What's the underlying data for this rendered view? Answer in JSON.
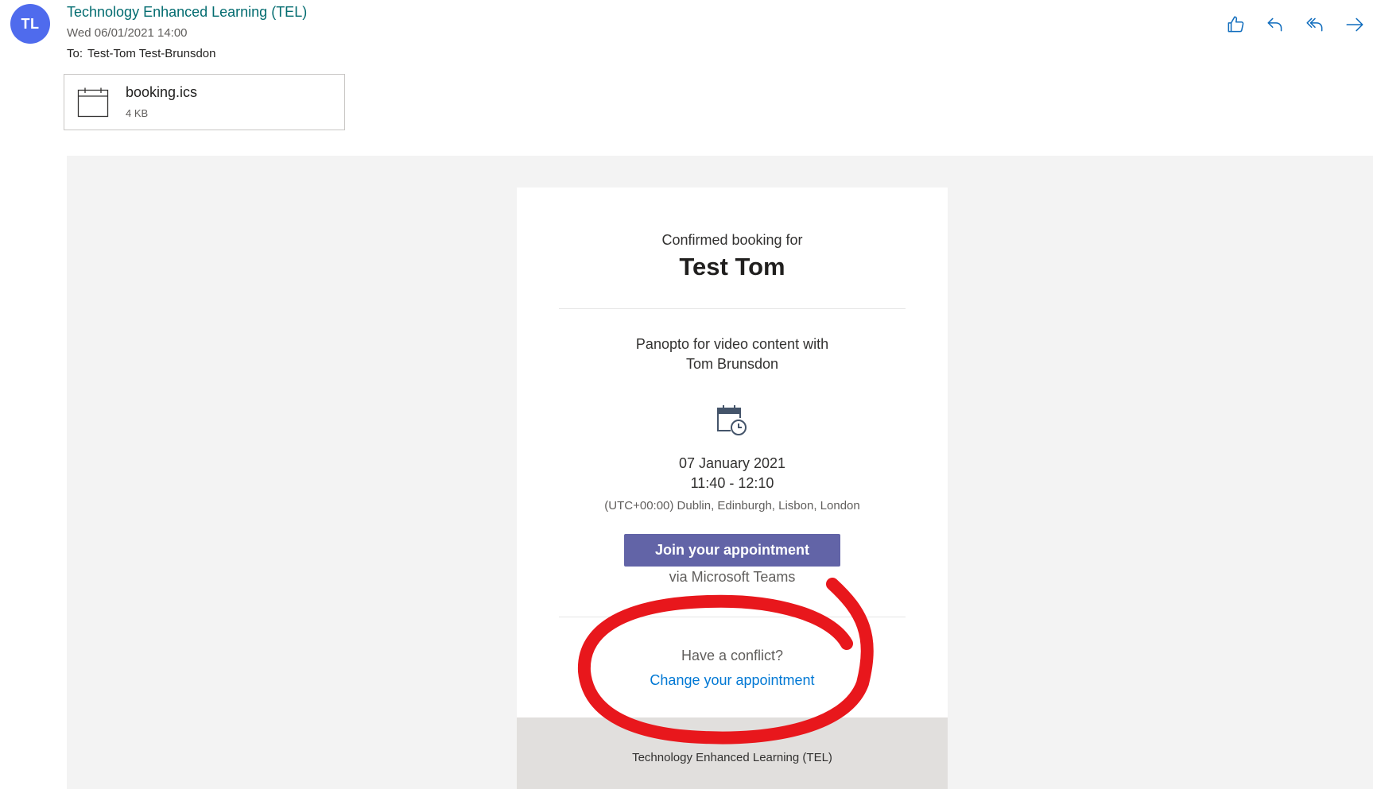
{
  "header": {
    "avatar_initials": "TL",
    "avatar_color": "#4f6bed",
    "sender_name": "Technology Enhanced Learning (TEL)",
    "sent_date": "Wed 06/01/2021 14:00",
    "to_label": "To:",
    "to_recipients": "Test-Tom Test-Brunsdon",
    "action_icons": [
      "like-icon",
      "reply-icon",
      "reply-all-icon",
      "forward-icon"
    ]
  },
  "attachment": {
    "file_name": "booking.ics",
    "file_size": "4 KB",
    "icon": "calendar-file-icon"
  },
  "booking_card": {
    "confirmed_label": "Confirmed booking for",
    "customer_name": "Test Tom",
    "service_line1": "Panopto for video content with",
    "service_line2": "Tom Brunsdon",
    "date": "07 January 2021",
    "time": "11:40 - 12:10",
    "timezone": "(UTC+00:00) Dublin, Edinburgh, Lisbon, London",
    "join_button_label": "Join your appointment",
    "join_button_color": "#6264a7",
    "via_text": "via Microsoft Teams",
    "conflict_text": "Have a conflict?",
    "change_link_text": "Change your appointment",
    "link_color": "#0078d4",
    "footer_text": "Technology Enhanced Learning (TEL)"
  },
  "annotation": {
    "shape": "hand-drawn circle",
    "color": "#e8171c"
  }
}
